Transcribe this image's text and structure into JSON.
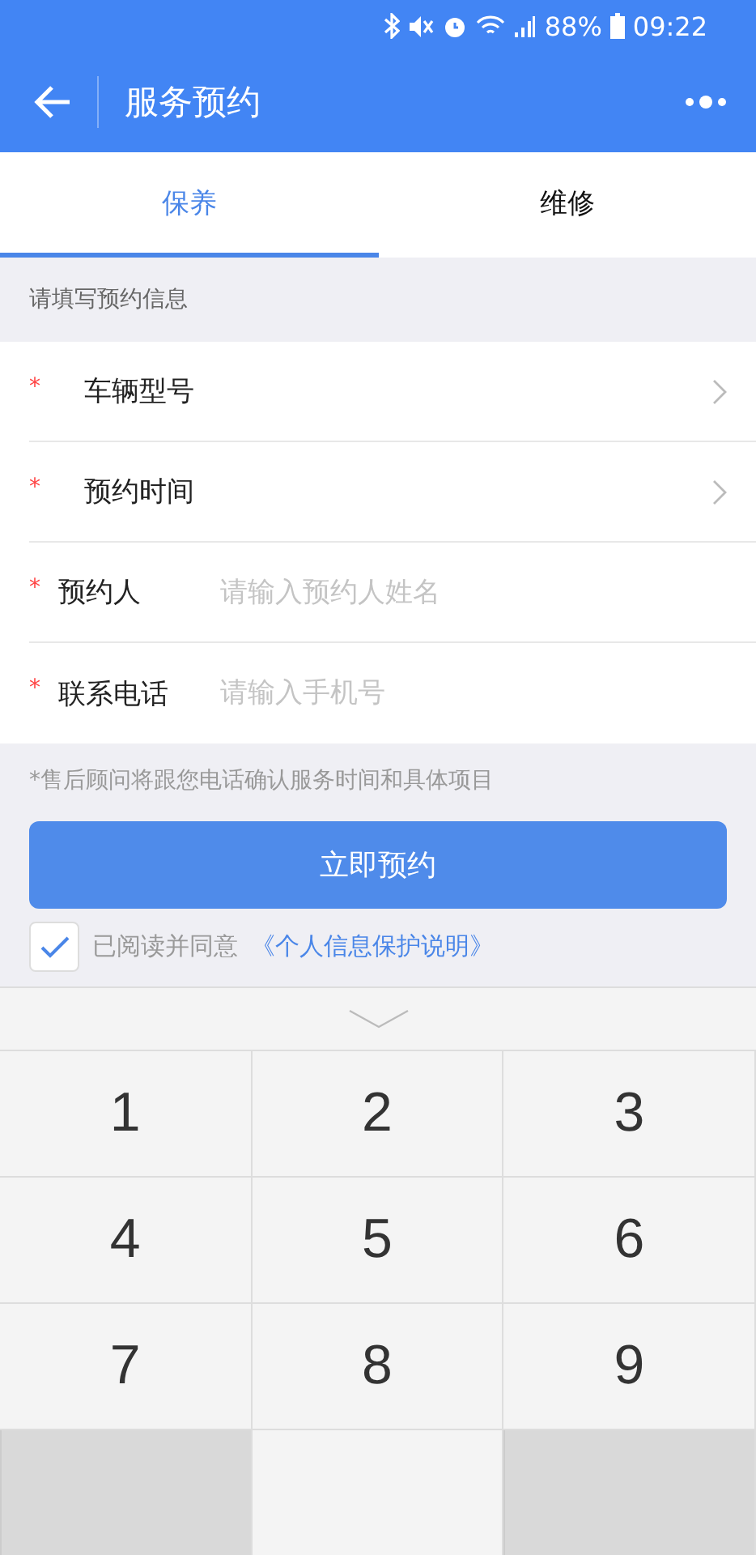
{
  "status_bar": {
    "battery": "88%",
    "time": "09:22"
  },
  "header": {
    "title": "服务预约"
  },
  "tabs": [
    {
      "label": "保养",
      "selected": true
    },
    {
      "label": "维修",
      "selected": false
    }
  ],
  "section_label": "请填写预约信息",
  "required_mark": "*",
  "form_rows": [
    {
      "kind": "select",
      "label": "车辆型号",
      "required": true
    },
    {
      "kind": "select",
      "label": "预约时间",
      "required": true
    },
    {
      "kind": "input",
      "label": "预约人",
      "required": true,
      "placeholder": "请输入预约人姓名"
    },
    {
      "kind": "input",
      "label": "联系电话",
      "required": true,
      "placeholder": "请输入手机号"
    }
  ],
  "note": "*售后顾问将跟您电话确认服务时间和具体项目",
  "submit_button": "立即预约",
  "agreement": {
    "checked": true,
    "text": "已阅读并同意",
    "link": "《个人信息保护说明》"
  },
  "keypad": {
    "keys": [
      {
        "label": "1",
        "kind": "digit"
      },
      {
        "label": "2",
        "kind": "digit"
      },
      {
        "label": "3",
        "kind": "digit"
      },
      {
        "label": "4",
        "kind": "digit"
      },
      {
        "label": "5",
        "kind": "digit"
      },
      {
        "label": "6",
        "kind": "digit"
      },
      {
        "label": "7",
        "kind": "digit"
      },
      {
        "label": "8",
        "kind": "digit"
      },
      {
        "label": "9",
        "kind": "digit"
      },
      {
        "kind": "blank"
      },
      {
        "kind": "blank-light"
      },
      {
        "kind": "blank"
      }
    ]
  }
}
